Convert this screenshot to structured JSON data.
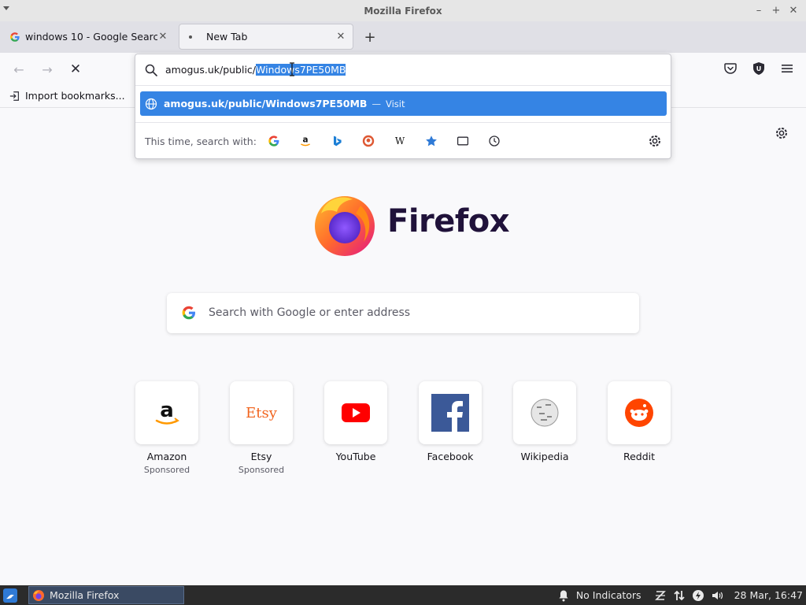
{
  "window": {
    "title": "Mozilla Firefox"
  },
  "tabs": [
    {
      "title": "windows 10 - Google Search"
    },
    {
      "title": "New Tab"
    }
  ],
  "bookmarks": {
    "import_label": "Import bookmarks..."
  },
  "urlbar": {
    "text_prefix": "amogus.uk/public/",
    "text_selected": "Windows7PE50MB",
    "result_url": "amogus.uk/public/Windows7PE50MB",
    "result_sep": "—",
    "result_action": "Visit",
    "search_with_label": "This time, search with:",
    "engines": [
      "google-icon",
      "amazon-icon",
      "bing-icon",
      "duckduckgo-icon",
      "wikipedia-icon",
      "bookmarks-icon",
      "tabs-icon",
      "history-icon"
    ]
  },
  "page": {
    "brand": "Firefox",
    "search_placeholder": "Search with Google or enter address",
    "top_sites": [
      {
        "name": "Amazon",
        "sponsored": "Sponsored"
      },
      {
        "name": "Etsy",
        "sponsored": "Sponsored",
        "logo_text": "Etsy"
      },
      {
        "name": "YouTube"
      },
      {
        "name": "Facebook"
      },
      {
        "name": "Wikipedia"
      },
      {
        "name": "Reddit"
      }
    ]
  },
  "taskbar": {
    "app_label": "Mozilla Firefox",
    "indicators": "No Indicators",
    "clock": "28 Mar, 16:47"
  },
  "colors": {
    "accent": "#3584e4",
    "taskbar": "#2b2b2b"
  }
}
